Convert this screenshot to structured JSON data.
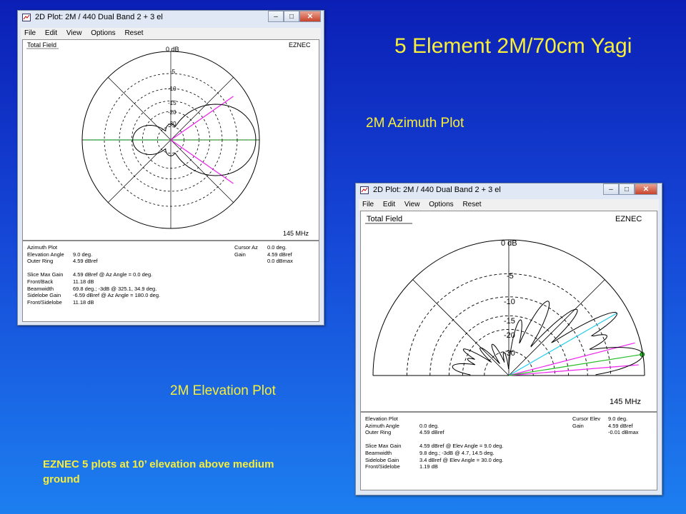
{
  "slide": {
    "title": "5 Element 2M/70cm Yagi",
    "azimuth_caption": "2M Azimuth Plot",
    "elevation_caption": "2M Elevation Plot",
    "note": "EZNEC 5 plots at 10’ elevation above medium ground"
  },
  "az_window": {
    "title": "2D Plot: 2M / 440 Dual Band 2 + 3 el",
    "menu": [
      "File",
      "Edit",
      "View",
      "Options",
      "Reset"
    ],
    "plot_label": "Total Field",
    "brand": "EZNEC",
    "freq": "145 MHz",
    "rings": [
      "0 dB",
      "-5",
      "-10",
      "-15",
      "-20",
      "-30"
    ],
    "info_left": [
      {
        "k": "Azimuth Plot",
        "v": ""
      },
      {
        "k": "Elevation Angle",
        "v": "9.0 deg."
      },
      {
        "k": "Outer Ring",
        "v": "4.59 dBref"
      },
      {
        "k": "",
        "v": ""
      },
      {
        "k": "Slice Max Gain",
        "v": "4.59 dBref @ Az Angle = 0.0 deg."
      },
      {
        "k": "Front/Back",
        "v": "11.18 dB"
      },
      {
        "k": "Beamwidth",
        "v": "69.8 deg.; -3dB @ 325.1, 34.9 deg."
      },
      {
        "k": "Sidelobe Gain",
        "v": "-6.59 dBref @ Az Angle = 180.0 deg."
      },
      {
        "k": "Front/Sidelobe",
        "v": "11.18 dB"
      }
    ],
    "info_right": [
      {
        "k": "Cursor Az",
        "v": "0.0 deg."
      },
      {
        "k": "Gain",
        "v": "4.59 dBref"
      },
      {
        "k": "",
        "v": "0.0 dBmax"
      }
    ]
  },
  "el_window": {
    "title": "2D Plot: 2M / 440 Dual Band 2 + 3 el",
    "menu": [
      "File",
      "Edit",
      "View",
      "Options",
      "Reset"
    ],
    "plot_label": "Total Field",
    "brand": "EZNEC",
    "freq": "145 MHz",
    "rings": [
      "0 dB",
      "-5",
      "-10",
      "-15",
      "-20",
      "-30"
    ],
    "info_left": [
      {
        "k": "Elevation Plot",
        "v": ""
      },
      {
        "k": "Azimuth Angle",
        "v": "0.0 deg."
      },
      {
        "k": "Outer Ring",
        "v": "4.59 dBref"
      },
      {
        "k": "",
        "v": ""
      },
      {
        "k": "Slice Max Gain",
        "v": "4.59 dBref @ Elev Angle = 9.0 deg."
      },
      {
        "k": "Beamwidth",
        "v": "9.8 deg.; -3dB @ 4.7, 14.5 deg."
      },
      {
        "k": "Sidelobe Gain",
        "v": "3.4 dBref @ Elev Angle = 30.0 deg."
      },
      {
        "k": "Front/Sidelobe",
        "v": "1.19 dB"
      }
    ],
    "info_right": [
      {
        "k": "Cursor Elev",
        "v": "9.0 deg."
      },
      {
        "k": "Gain",
        "v": "4.59 dBref"
      },
      {
        "k": "",
        "v": "-0.01 dBmax"
      }
    ]
  },
  "colors": {
    "pattern": "#000000",
    "cursor": "#22bb22",
    "beamwidth": "#ee22ee",
    "sidelobe": "#22ccee",
    "title_text": "#f7ee3a"
  }
}
